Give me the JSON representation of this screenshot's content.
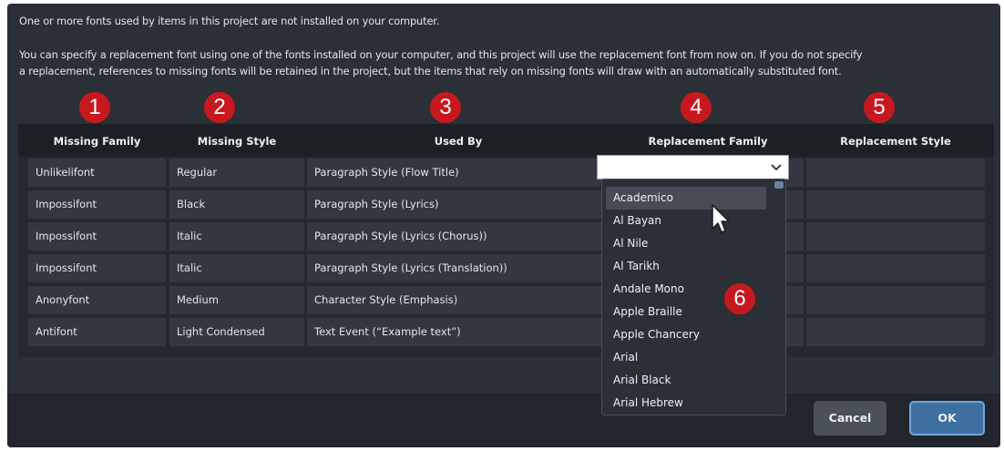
{
  "message": {
    "line1": "One or more fonts used by items in this project are not installed on your computer.",
    "line2a": "You can specify a replacement font using one of the fonts installed on your computer, and this project will use the replacement font from now on. If you do not specify",
    "line2b": "a replacement, references to missing fonts will be retained in the project, but the items that rely on missing fonts will draw with an automatically substituted font."
  },
  "columns": [
    "Missing Family",
    "Missing Style",
    "Used By",
    "Replacement Family",
    "Replacement Style"
  ],
  "badges": [
    "1",
    "2",
    "3",
    "4",
    "5",
    "6"
  ],
  "rows": [
    {
      "family": "Unlikelifont",
      "style": "Regular",
      "used_by": "Paragraph Style (Flow Title)"
    },
    {
      "family": "Impossifont",
      "style": "Black",
      "used_by": "Paragraph Style (Lyrics)"
    },
    {
      "family": "Impossifont",
      "style": "Italic",
      "used_by": "Paragraph Style (Lyrics (Chorus))"
    },
    {
      "family": "Impossifont",
      "style": "Italic",
      "used_by": "Paragraph Style (Lyrics (Translation))"
    },
    {
      "family": "Anonyfont",
      "style": "Medium",
      "used_by": "Character Style (Emphasis)"
    },
    {
      "family": "Antifont",
      "style": "Light Condensed",
      "used_by": "Text Event (“Example text”)"
    }
  ],
  "dropdown": {
    "value": "",
    "arrow_icon": "chevron-down-icon"
  },
  "font_list": {
    "selected": "Academico",
    "items": [
      "Academico",
      "Al Bayan",
      "Al Nile",
      "Al Tarikh",
      "Andale Mono",
      "Apple Braille",
      "Apple Chancery",
      "Arial",
      "Arial Black",
      "Arial Hebrew"
    ]
  },
  "buttons": {
    "cancel": "Cancel",
    "ok": "OK"
  },
  "colors": {
    "badge": "#c8181f",
    "ok_button": "#3e6fa0",
    "ok_border": "#6fa6e0"
  }
}
